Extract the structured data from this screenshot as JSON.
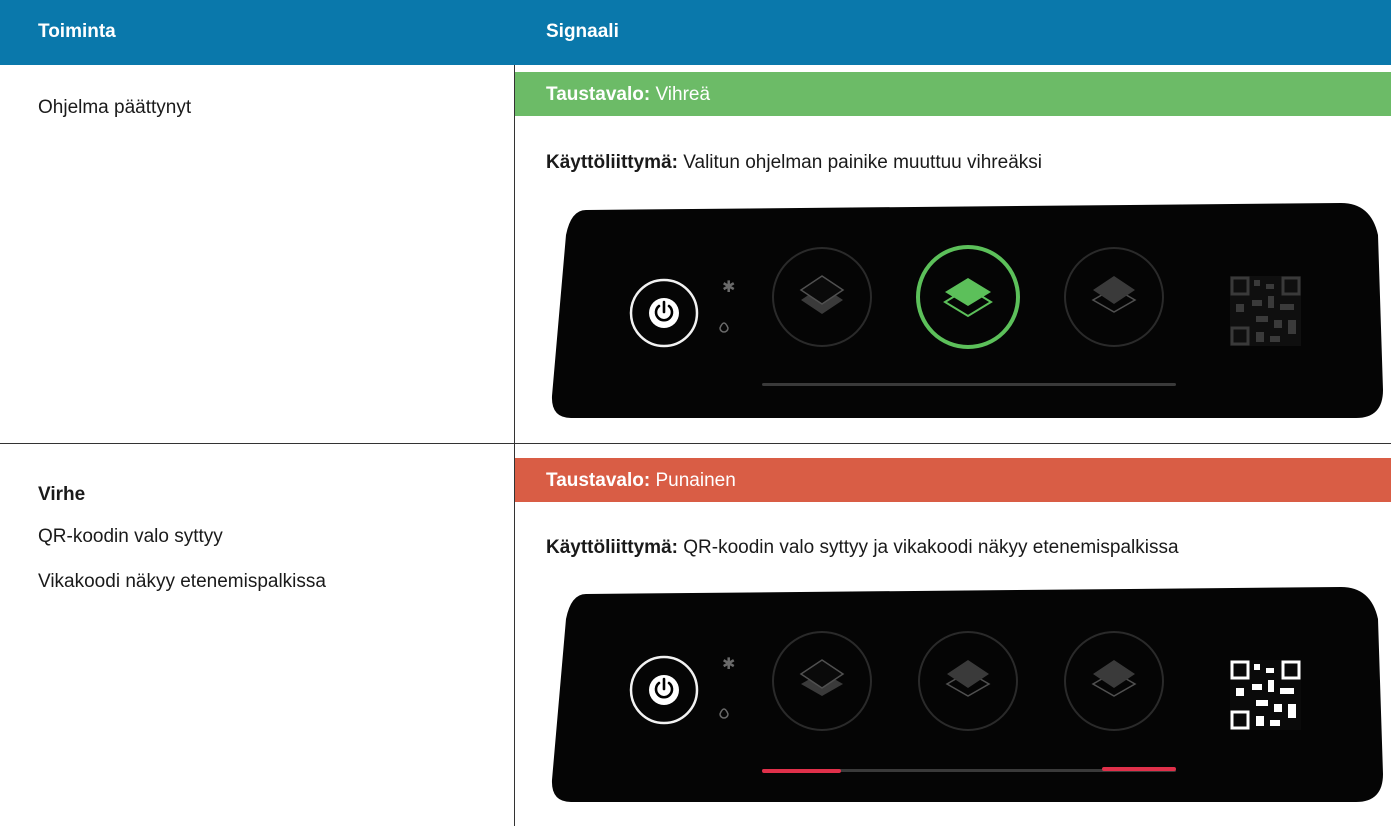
{
  "header": {
    "col1": "Toiminta",
    "col2": "Signaali"
  },
  "rows": [
    {
      "action": "Ohjelma päättynyt",
      "backlight_label": "Taustavalo:",
      "backlight_value": "Vihreä",
      "backlight_color": "#6cbb67",
      "ui_label": "Käyttöliittymä:",
      "ui_value": "Valitun ohjelman painike muuttuu vihreäksi",
      "panel": {
        "power_icon": "power-icon",
        "bluetooth_icon": "bluetooth-icon",
        "water_icon": "water-drop-icon",
        "program_buttons": [
          "layers-program-1",
          "layers-program-2",
          "layers-program-3"
        ],
        "selected_program": 2,
        "selected_color": "#5cc05a",
        "qr_lit": false,
        "progress_error": false
      }
    },
    {
      "action_title": "Virhe",
      "action_lines": [
        "QR-koodin valo syttyy",
        "Vikakoodi näkyy etenemispalkissa"
      ],
      "backlight_label": "Taustavalo:",
      "backlight_value": "Punainen",
      "backlight_color": "#d95d45",
      "ui_label": "Käyttöliittymä:",
      "ui_value": "QR-koodin valo syttyy ja vikakoodi näkyy etenemispalkissa",
      "panel": {
        "power_icon": "power-icon",
        "bluetooth_icon": "bluetooth-icon",
        "water_icon": "water-drop-icon",
        "program_buttons": [
          "layers-program-1",
          "layers-program-2",
          "layers-program-3"
        ],
        "selected_program": 0,
        "qr_lit": true,
        "progress_error": true,
        "error_color": "#e0304a"
      }
    }
  ]
}
